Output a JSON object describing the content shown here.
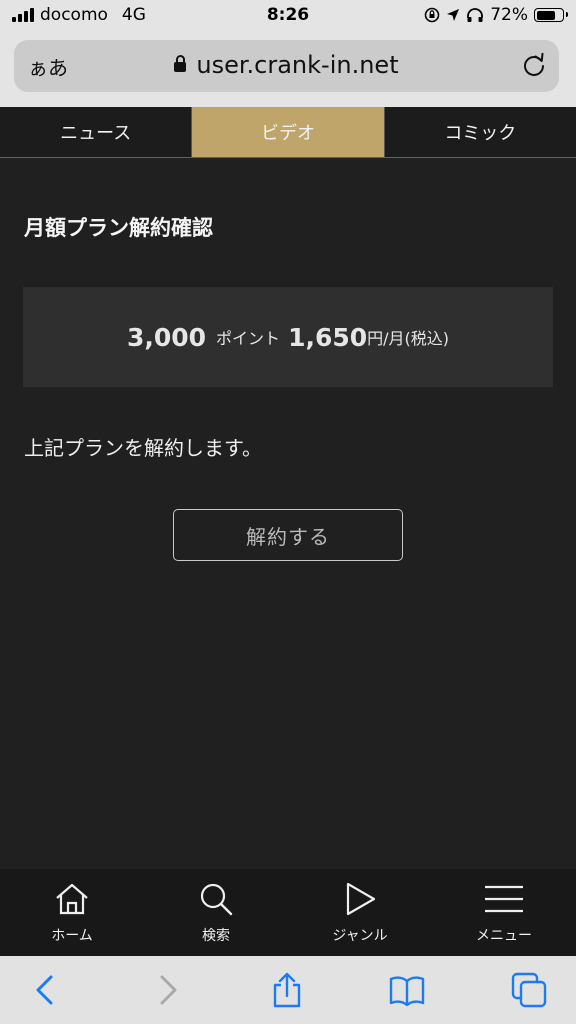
{
  "status": {
    "carrier": "docomo",
    "network": "4G",
    "time": "8:26",
    "battery": "72%",
    "battery_level": 0.72
  },
  "browser": {
    "text_size": "ぁあ",
    "url": "user.crank-in.net"
  },
  "tabs": [
    {
      "label": "ニュース",
      "active": false
    },
    {
      "label": "ビデオ",
      "active": true
    },
    {
      "label": "コミック",
      "active": false
    }
  ],
  "main": {
    "title": "月額プラン解約確認",
    "plan": {
      "points": "3,000",
      "points_label": "ポイント",
      "price": "1,650",
      "unit": "円/月(税込)"
    },
    "description": "上記プランを解約します。",
    "cancel_button": "解約する"
  },
  "site_nav": [
    {
      "label": "ホーム",
      "icon": "home-icon"
    },
    {
      "label": "検索",
      "icon": "search-icon"
    },
    {
      "label": "ジャンル",
      "icon": "play-icon"
    },
    {
      "label": "メニュー",
      "icon": "menu-icon"
    }
  ],
  "colors": {
    "accent": "#bfa56a",
    "background": "#202020",
    "toolbar_blue": "#1a7cf5"
  }
}
